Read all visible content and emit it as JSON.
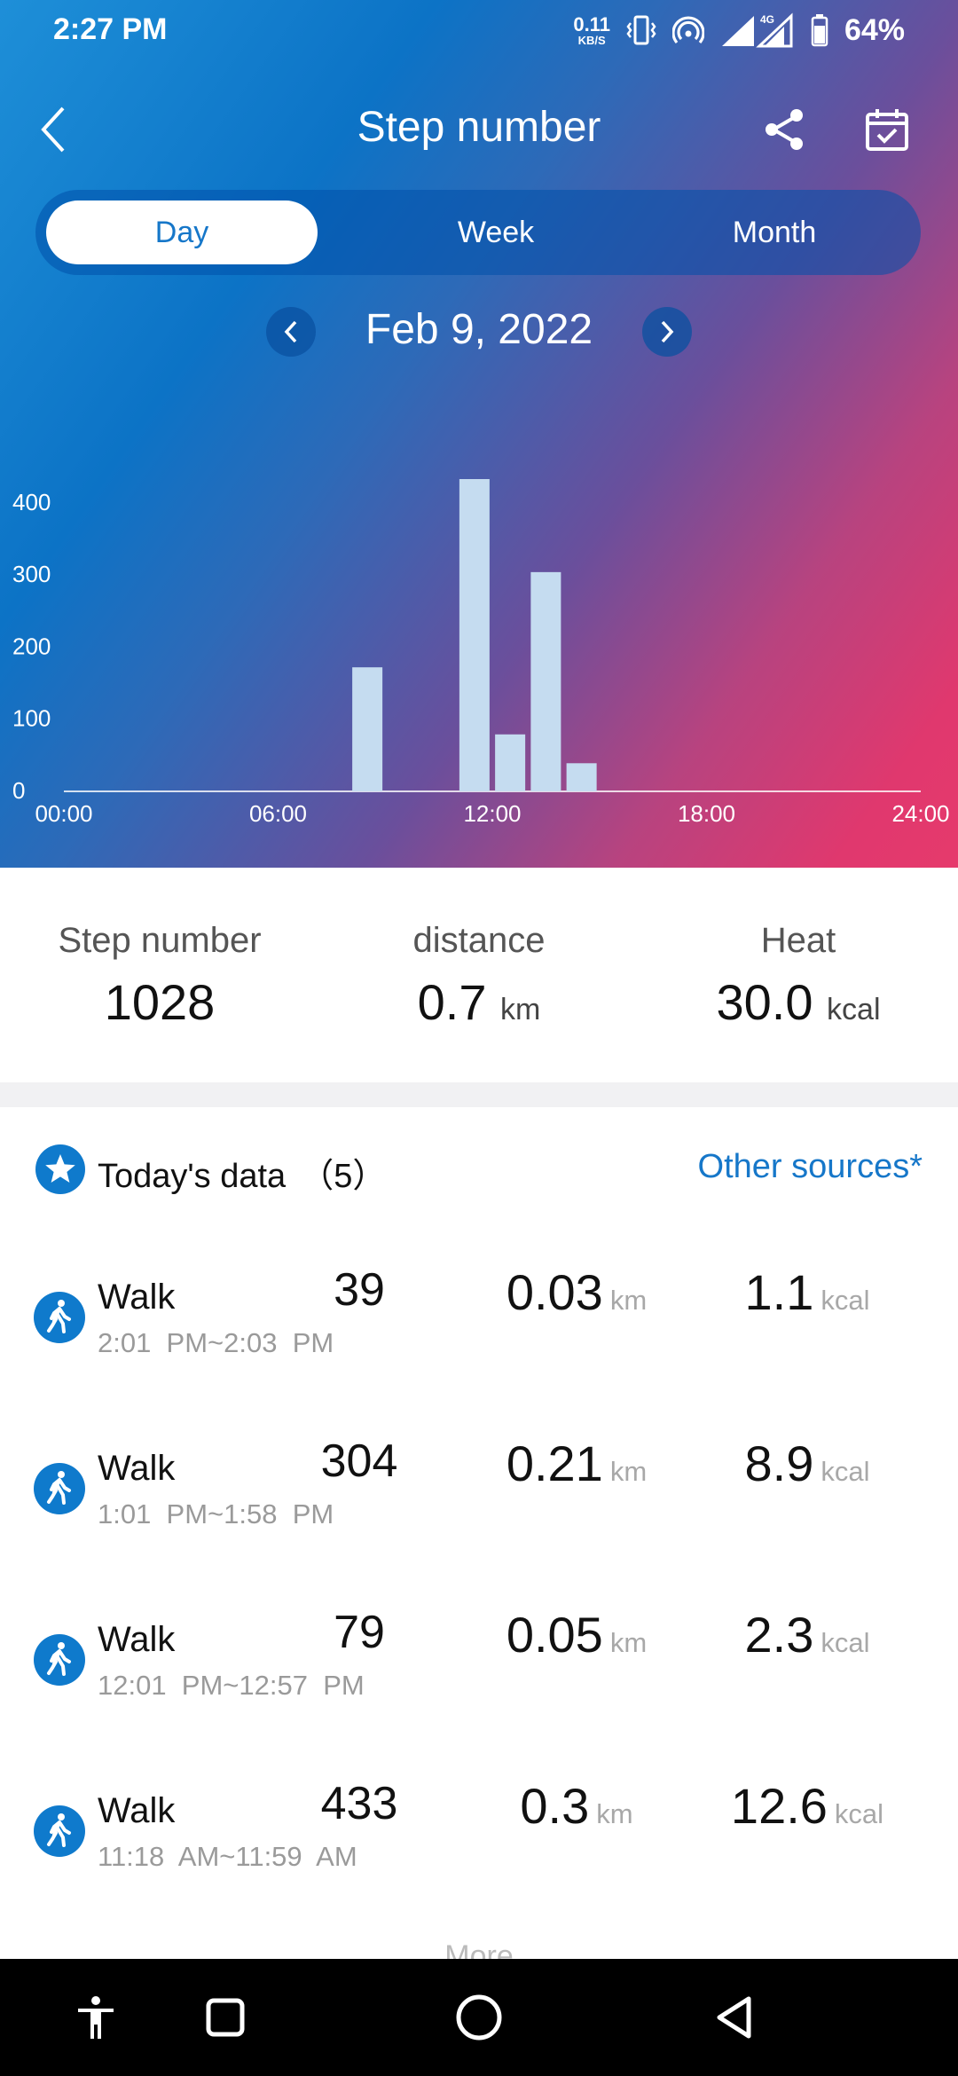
{
  "status_bar": {
    "time": "2:27 PM",
    "net_speed_value": "0.11",
    "net_speed_unit": "KB/S",
    "network_label": "4G",
    "battery": "64%"
  },
  "header": {
    "title": "Step number",
    "tabs": [
      {
        "label": "Day",
        "selected": true
      },
      {
        "label": "Week",
        "selected": false
      },
      {
        "label": "Month",
        "selected": false
      }
    ],
    "date": "Feb 9, 2022"
  },
  "chart_data": {
    "type": "bar",
    "x_ticks": [
      "00:00",
      "06:00",
      "12:00",
      "18:00",
      "24:00"
    ],
    "y_ticks": [
      "0",
      "100",
      "200",
      "300",
      "400"
    ],
    "xlim": [
      0,
      24
    ],
    "ylim": [
      0,
      433
    ],
    "bars": [
      {
        "hour": 8,
        "value": 172
      },
      {
        "hour": 11,
        "value": 433
      },
      {
        "hour": 12,
        "value": 79
      },
      {
        "hour": 13,
        "value": 304
      },
      {
        "hour": 14,
        "value": 39
      }
    ],
    "bar_color": "#c5dcf0"
  },
  "summary": {
    "steps_label": "Step number",
    "steps_value": "1028",
    "distance_label": "distance",
    "distance_value": "0.7",
    "distance_unit": "km",
    "heat_label": "Heat",
    "heat_value": "30.0",
    "heat_unit": "kcal"
  },
  "today": {
    "title": "Today's data",
    "count": "（5）",
    "other_sources": "Other sources*"
  },
  "records": [
    {
      "type": "Walk",
      "time": "2:01  PM~2:03  PM",
      "steps": "39",
      "distance": "0.03",
      "distance_unit": "km",
      "heat": "1.1",
      "heat_unit": "kcal"
    },
    {
      "type": "Walk",
      "time": "1:01  PM~1:58  PM",
      "steps": "304",
      "distance": "0.21",
      "distance_unit": "km",
      "heat": "8.9",
      "heat_unit": "kcal"
    },
    {
      "type": "Walk",
      "time": "12:01  PM~12:57  PM",
      "steps": "79",
      "distance": "0.05",
      "distance_unit": "km",
      "heat": "2.3",
      "heat_unit": "kcal"
    },
    {
      "type": "Walk",
      "time": "11:18  AM~11:59  AM",
      "steps": "433",
      "distance": "0.3",
      "distance_unit": "km",
      "heat": "12.6",
      "heat_unit": "kcal"
    }
  ],
  "more_label": "More",
  "colors": {
    "accent": "#1677c9",
    "icon_blue": "#0f7acc"
  }
}
